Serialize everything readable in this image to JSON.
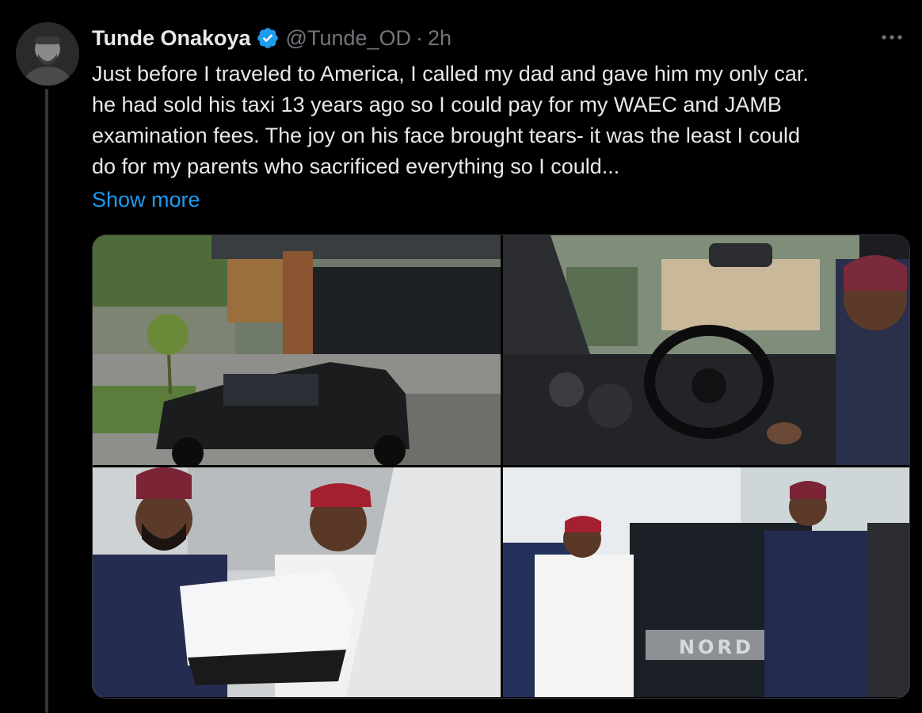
{
  "tweet": {
    "author_name": "Tunde Onakoya",
    "handle": "@Tunde_OD",
    "separator": "·",
    "time": "2h",
    "verified_color": "#1d9bf0",
    "text_lines": [
      "Just before I traveled to America, I called my dad and gave him my only car.",
      "he had sold his taxi 13 years ago so I could pay for my WAEC and JAMB",
      "examination fees. The joy on his face brought tears- it was the least I could",
      "do for my parents who sacrificed everything so I could..."
    ],
    "show_more": "Show more",
    "more_icon": "more-horizontal-icon",
    "photo_count": 4,
    "photo_4_grille_text": "NORD"
  },
  "colors": {
    "background": "#000000",
    "text": "#e7e9ea",
    "muted": "#71767b",
    "link": "#1d9bf0"
  }
}
